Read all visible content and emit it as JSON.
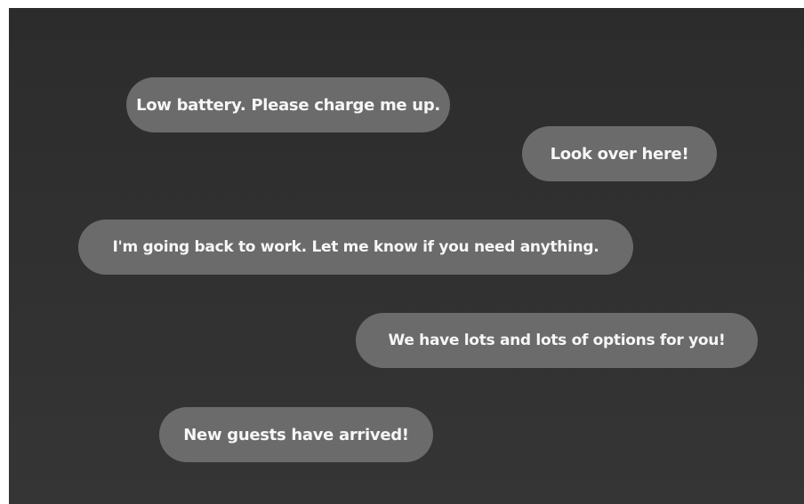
{
  "colors": {
    "background": "#303030",
    "bubble": "#6b6b6b",
    "text": "#f6f6f6"
  },
  "notifications": [
    {
      "text": "Low battery. Please charge me up."
    },
    {
      "text": "Look over here!"
    },
    {
      "text": "I'm going back to work. Let me know if you need anything."
    },
    {
      "text": "We have lots and lots of options for you!"
    },
    {
      "text": "New guests have arrived!"
    }
  ]
}
